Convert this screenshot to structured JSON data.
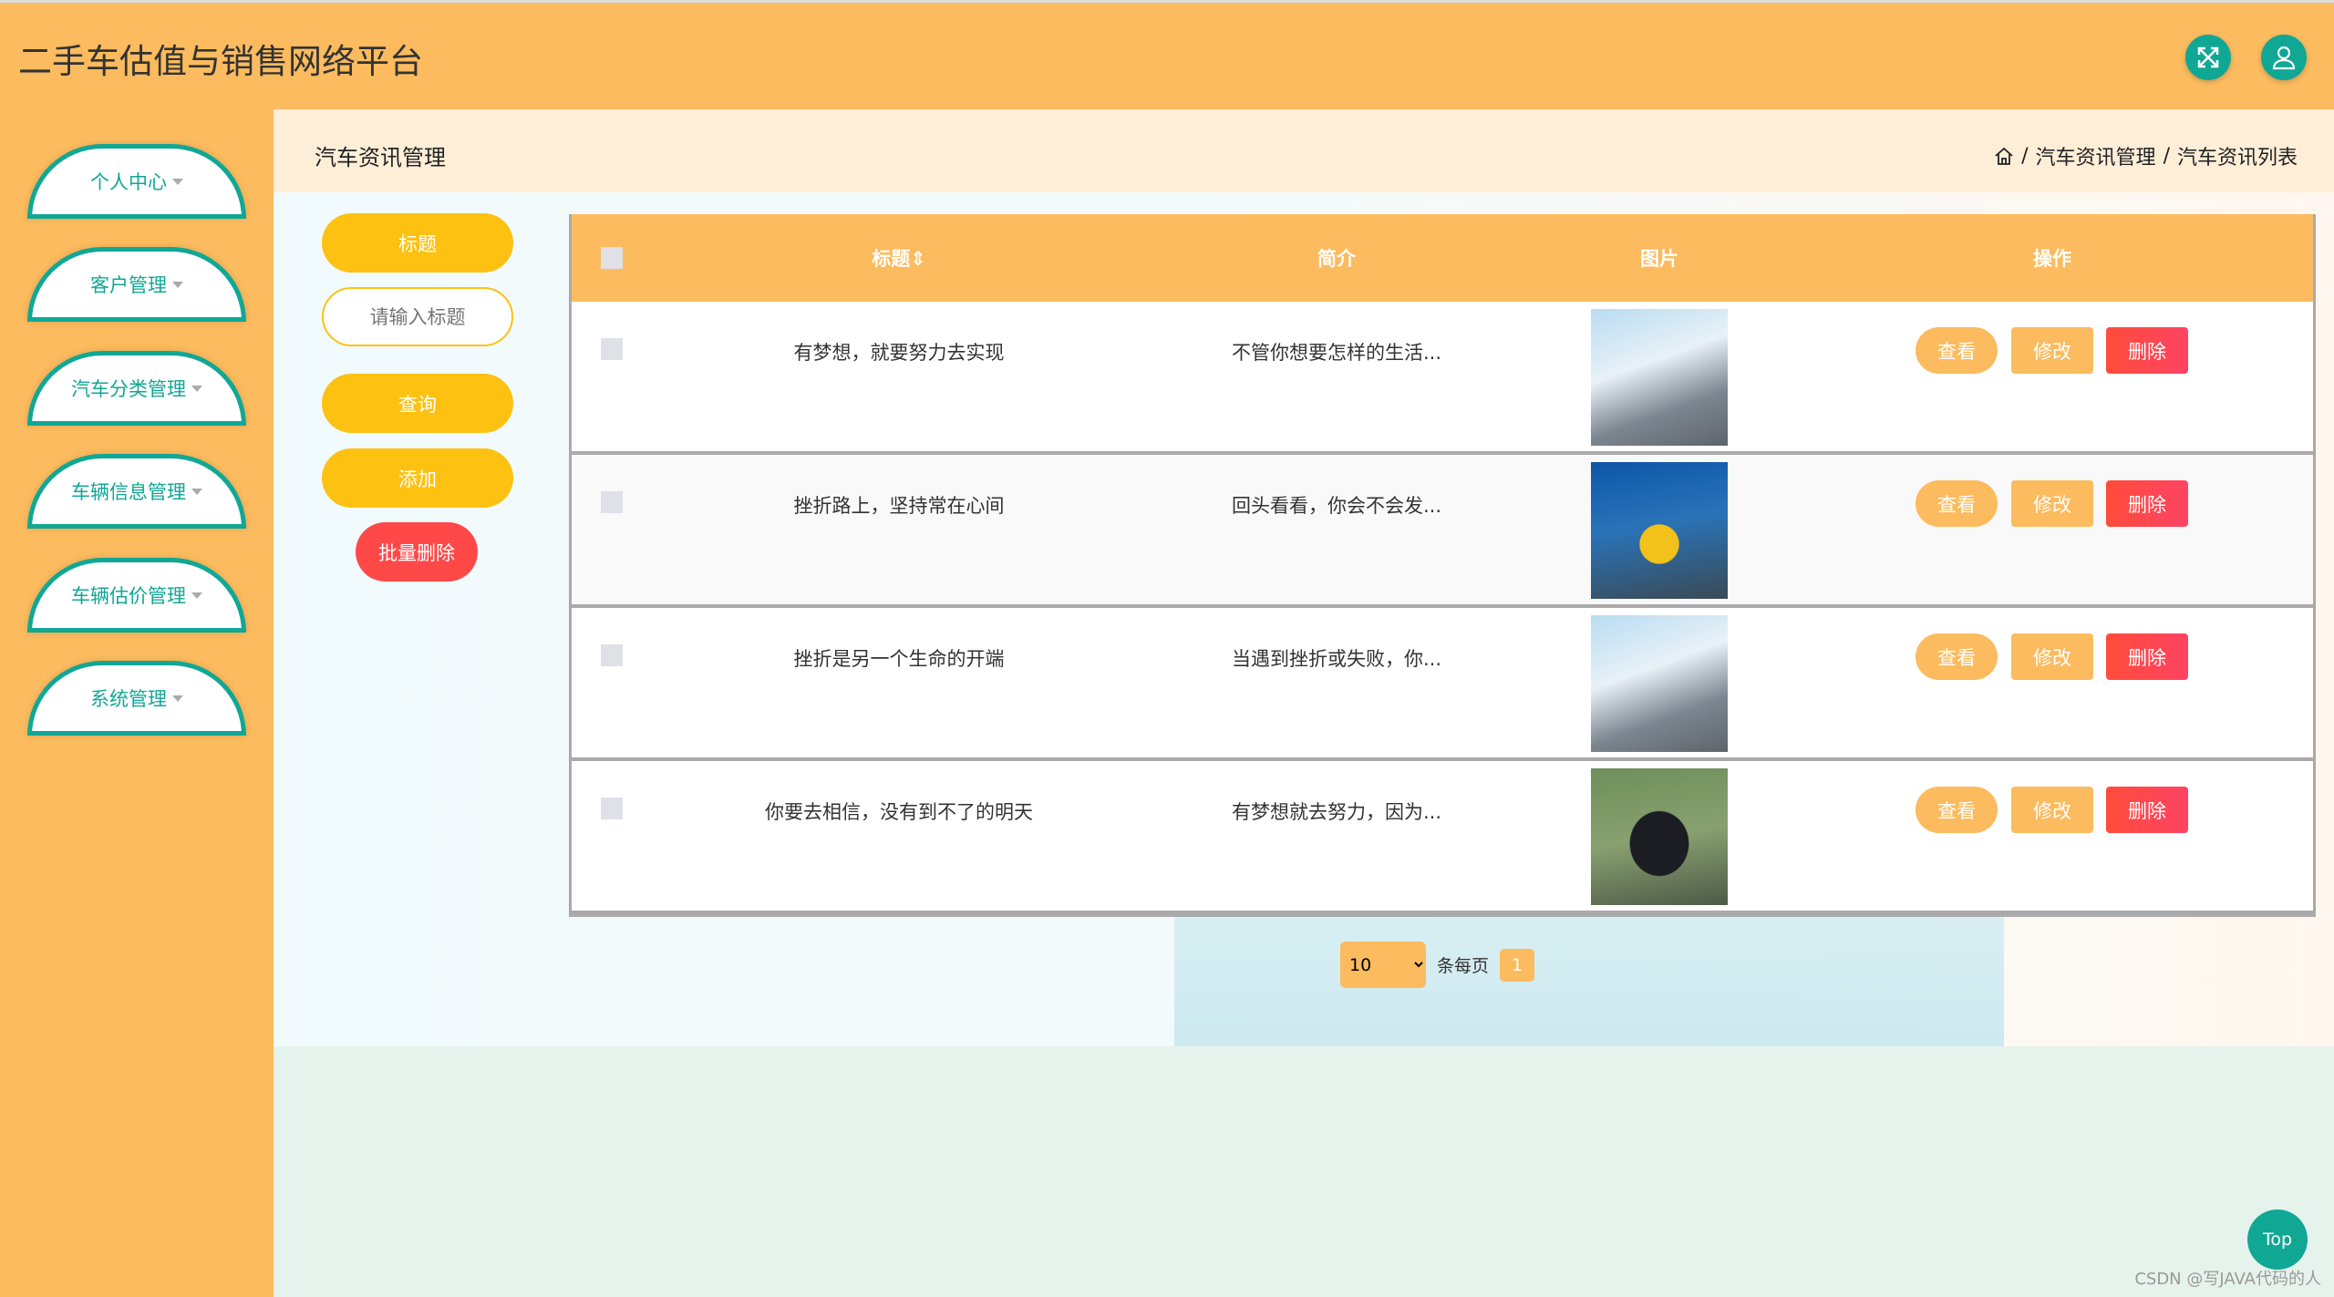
{
  "header": {
    "title": "二手车估值与销售网络平台",
    "fullscreen_icon": "expand-icon",
    "user_icon": "user-icon"
  },
  "sidebar": {
    "items": [
      {
        "label": "个人中心"
      },
      {
        "label": "客户管理"
      },
      {
        "label": "汽车分类管理"
      },
      {
        "label": "车辆信息管理"
      },
      {
        "label": "车辆估价管理"
      },
      {
        "label": "系统管理"
      }
    ]
  },
  "page": {
    "title": "汽车资讯管理",
    "breadcrumb": [
      "汽车资讯管理",
      "汽车资讯列表"
    ],
    "sep": "/"
  },
  "search": {
    "field_label": "标题",
    "placeholder": "请输入标题",
    "query": "查询",
    "add": "添加",
    "batch_delete": "批量删除"
  },
  "table": {
    "headers": {
      "title": "标题⇕",
      "intro": "简介",
      "image": "图片",
      "ops": "操作"
    },
    "rows": [
      {
        "title": "有梦想，就要努力去实现",
        "intro": "不管你想要怎样的生活...",
        "image": "bridge-car"
      },
      {
        "title": "挫折路上，坚持常在心间",
        "intro": "回头看看，你会不会发...",
        "image": "yellow-car"
      },
      {
        "title": "挫折是另一个生命的开端",
        "intro": "当遇到挫折或失败，你...",
        "image": "bridge-car"
      },
      {
        "title": "你要去相信，没有到不了的明天",
        "intro": "有梦想就去努力，因为...",
        "image": "black-car"
      }
    ],
    "ops": {
      "view": "查看",
      "edit": "修改",
      "delete": "删除"
    }
  },
  "pagination": {
    "page_size": "10",
    "per_page_label": "条每页",
    "current_page": "1"
  },
  "top_button": "Top",
  "watermark": "CSDN @写JAVA代码的人",
  "colors": {
    "primary": "#fbbb5e",
    "accent": "#10a795",
    "button": "#fdc112",
    "danger": "#ff4949"
  }
}
